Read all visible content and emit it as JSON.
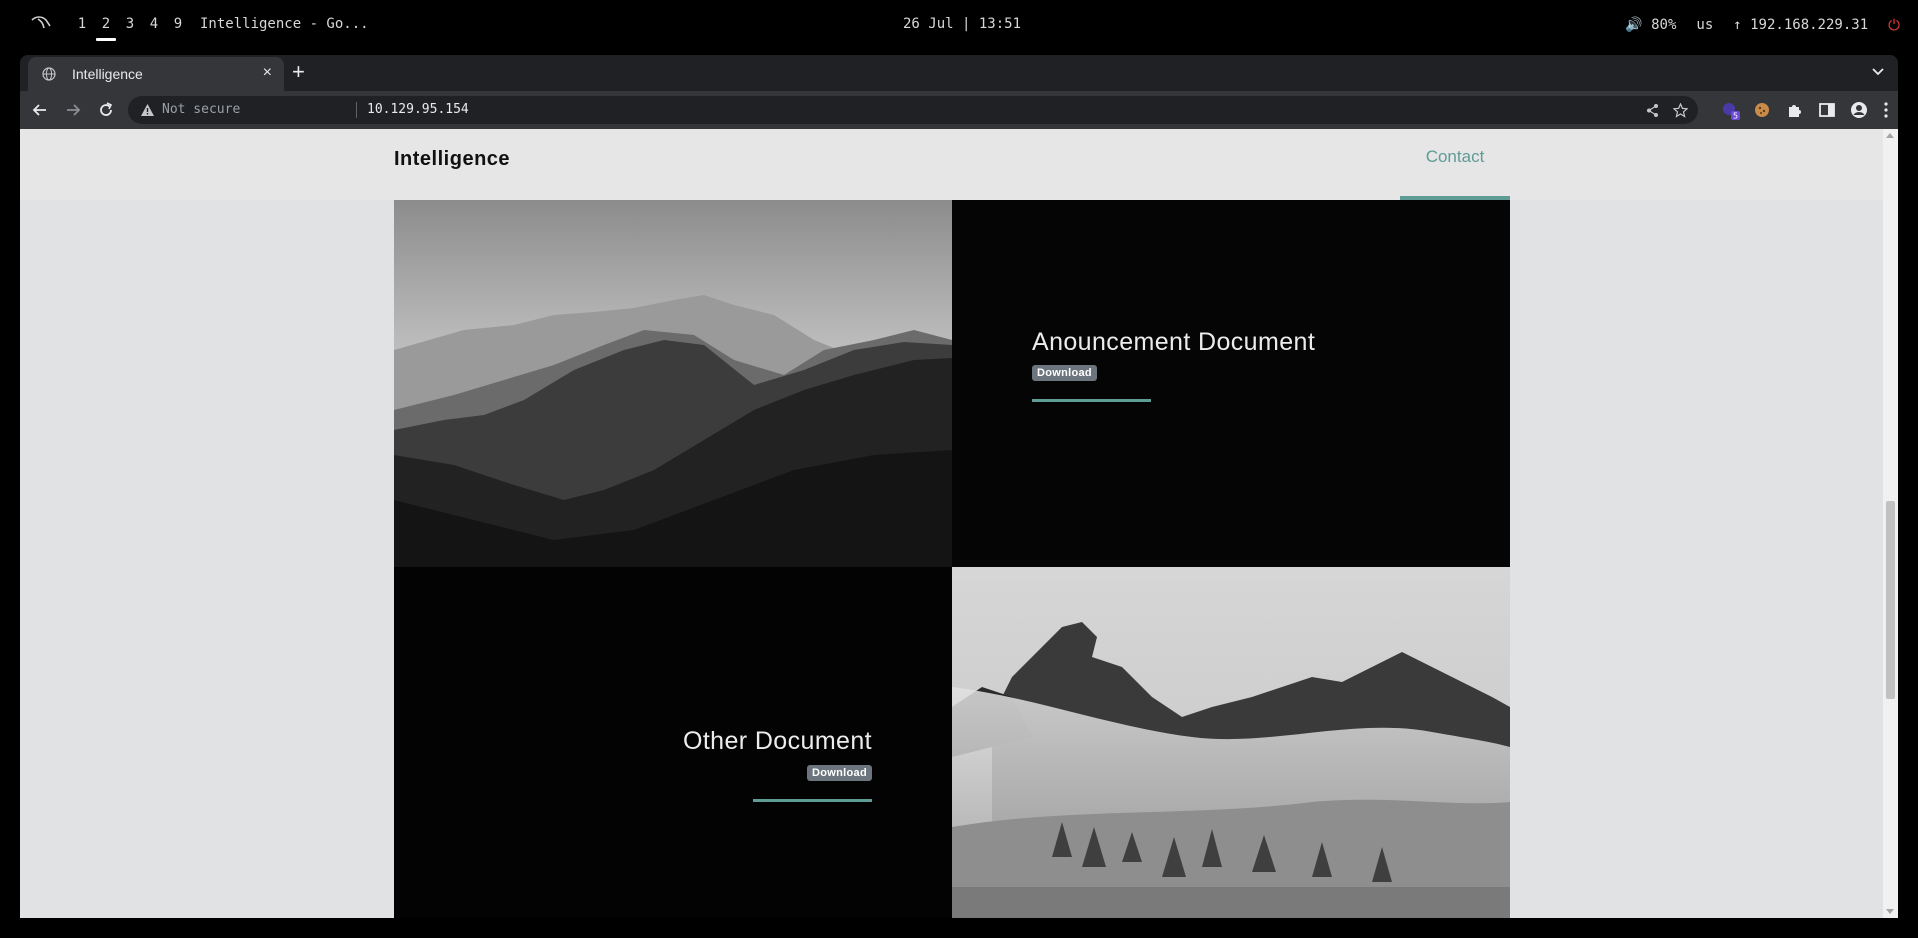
{
  "system_bar": {
    "workspaces": [
      "1",
      "2",
      "3",
      "4",
      "9"
    ],
    "active_workspace": "2",
    "window_title": "Intelligence - Go...",
    "datetime": "26 Jul | 13:51",
    "volume": "🔊 80%",
    "keyboard_layout": "us",
    "ip_address": "↑ 192.168.229.31",
    "power_icon": "power-icon"
  },
  "browser": {
    "tab_title": "Intelligence",
    "tab_close": "×",
    "new_tab": "+",
    "security_label": "Not secure",
    "url": "10.129.95.154",
    "extension_badge": "5"
  },
  "site": {
    "brand": "Intelligence",
    "nav_contact": "Contact",
    "accent_color": "#5f9c96",
    "documents": [
      {
        "title": "Anouncement Document",
        "button": "Download"
      },
      {
        "title": "Other Document",
        "button": "Download"
      }
    ]
  }
}
